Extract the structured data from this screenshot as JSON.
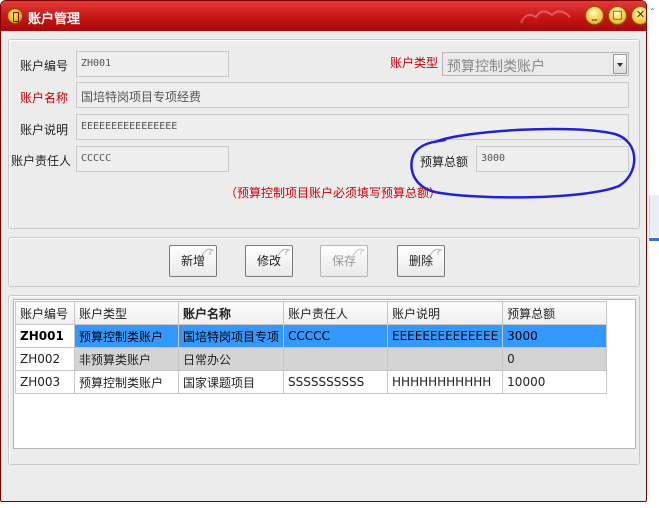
{
  "window": {
    "title": "账户管理",
    "controls": {
      "minimize": "_",
      "maximize": "□",
      "close": "✕"
    }
  },
  "form": {
    "account_no": {
      "label": "账户编号",
      "value": "ZH001"
    },
    "account_type": {
      "label": "账户类型",
      "value": "预算控制类账户"
    },
    "account_name": {
      "label": "账户名称",
      "value": "国培特岗项目专项经费"
    },
    "account_desc": {
      "label": "账户说明",
      "value": "EEEEEEEEEEEEEEEE"
    },
    "owner": {
      "label": "账户责任人",
      "value": "CCCCC"
    },
    "budget_total": {
      "label": "预算总额",
      "value": "3000"
    },
    "note": "（预算控制项目账户必须填写预算总额）"
  },
  "buttons": {
    "add": "新增",
    "edit": "修改",
    "save": "保存",
    "delete": "删除"
  },
  "grid": {
    "columns": [
      "账户编号",
      "账户类型",
      "账户名称",
      "账户责任人",
      "账户说明",
      "预算总额"
    ],
    "rows": [
      [
        "ZH001",
        "预算控制类账户",
        "国培特岗项目专项",
        "CCCCC",
        "EEEEEEEEEEEEEE",
        "3000"
      ],
      [
        "ZH002",
        "非预算类账户",
        "日常办公",
        "",
        "",
        "0"
      ],
      [
        "ZH003",
        "预算控制类账户",
        "国家课题项目",
        "SSSSSSSSSS",
        "HHHHHHHHHHH",
        "10000"
      ]
    ]
  },
  "colors": {
    "titlebar": "#c81515",
    "selected_row": "#3399ff",
    "required_label": "#c00000",
    "annotation": "#1f22d9"
  }
}
